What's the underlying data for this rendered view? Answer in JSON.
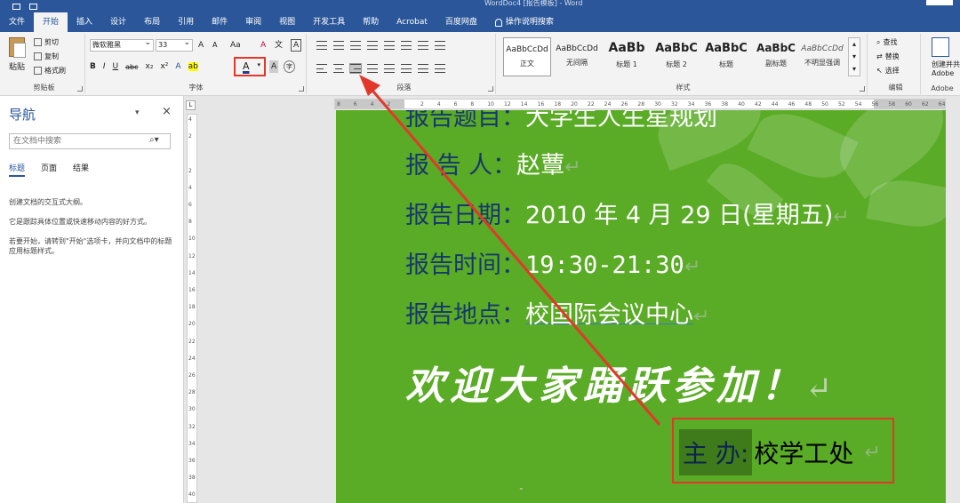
{
  "window": {
    "title": "WordDoc4 [报告模板] - Word"
  },
  "tabs": [
    {
      "label": "文件"
    },
    {
      "label": "开始",
      "active": true
    },
    {
      "label": "插入"
    },
    {
      "label": "设计"
    },
    {
      "label": "布局"
    },
    {
      "label": "引用"
    },
    {
      "label": "邮件"
    },
    {
      "label": "审阅"
    },
    {
      "label": "视图"
    },
    {
      "label": "开发工具"
    },
    {
      "label": "帮助"
    },
    {
      "label": "Acrobat"
    },
    {
      "label": "百度网盘"
    },
    {
      "label": "操作说明搜索"
    }
  ],
  "ribbon": {
    "clipboard": {
      "paste": "粘贴",
      "cut": "剪切",
      "copy": "复制",
      "format_painter": "格式刷",
      "label": "剪贴板"
    },
    "font": {
      "font_name": "微软雅黑",
      "font_size": "33",
      "grow": "A",
      "shrink": "A",
      "case": "Aa",
      "clear_format": "A",
      "pinyin": "文",
      "border": "A",
      "bold": "B",
      "italic": "I",
      "underline": "U",
      "strike": "abc",
      "subscript": "x₂",
      "superscript": "x²",
      "effects": "A",
      "highlight": "ab",
      "font_color": "A",
      "shading": "A",
      "enclose": "字",
      "label": "字体"
    },
    "paragraph": {
      "label": "段落"
    },
    "styles": {
      "label": "样式",
      "items": [
        {
          "sample": "AaBbCcDd",
          "name": "正文",
          "selected": true
        },
        {
          "sample": "AaBbCcDd",
          "name": "无间隔"
        },
        {
          "sample": "AaBb",
          "name": "标题 1"
        },
        {
          "sample": "AaBbC",
          "name": "标题 2"
        },
        {
          "sample": "AaBbC",
          "name": "标题"
        },
        {
          "sample": "AaBbC",
          "name": "副标题"
        },
        {
          "sample": "AaBbCcDd",
          "name": "不明显强调"
        }
      ]
    },
    "editing": {
      "find": "查找",
      "replace": "替换",
      "select": "选择",
      "label": "编辑"
    },
    "adobe": {
      "line1": "创建并共",
      "line2": "Adobe",
      "label": "Adobe"
    }
  },
  "nav": {
    "title": "导航",
    "search_placeholder": "在文档中搜索",
    "tabs": [
      {
        "label": "标题",
        "active": true
      },
      {
        "label": "页面"
      },
      {
        "label": "结果"
      }
    ],
    "text1": "创建文档的交互式大纲。",
    "text2": "它是跟踪具体位置或快速移动内容的好方式。",
    "text3": "若要开始，请转到\"开始\"选项卡，并向文档中的标题应用标题样式。"
  },
  "ruler": {
    "ticks": [
      "8",
      "6",
      "4",
      "2",
      "",
      "2",
      "4",
      "6",
      "8",
      "10",
      "12",
      "14",
      "16",
      "18",
      "20",
      "22",
      "24",
      "26",
      "28",
      "30",
      "32",
      "34",
      "36",
      "38",
      "40",
      "42",
      "44",
      "46",
      "48",
      "50",
      "52",
      "54",
      "56",
      "58",
      "60",
      "62",
      "64"
    ],
    "vticks": [
      "4",
      "",
      "2",
      "",
      "",
      "",
      "2",
      "",
      "4",
      "",
      "6",
      "",
      "8",
      "",
      "10",
      "",
      "12",
      "",
      "14",
      "",
      "16",
      "",
      "18",
      "",
      "20",
      "",
      "22",
      "",
      "24",
      "",
      "26",
      "",
      "28",
      "",
      "30",
      "",
      "32",
      "",
      "34",
      "",
      "36",
      "",
      "38",
      "",
      "40"
    ]
  },
  "document": {
    "line0": {
      "label": "报告题目：",
      "value": "大学生人生星规划"
    },
    "line1": {
      "label": "报 告 人：",
      "value": "赵蕈"
    },
    "line2": {
      "label": "报告日期：",
      "value": "2010 年 4 月 29 日(星期五)"
    },
    "line3": {
      "label": "报告时间：",
      "value": "19:30-21:30"
    },
    "line4": {
      "label": "报告地点：",
      "value": "校国际会议中心"
    },
    "welcome": "欢迎大家踊跃参加！",
    "sponsor_label": "主 办",
    "sponsor_sep": ":",
    "sponsor_value": "校学工处",
    "para_mark": "↵"
  },
  "colors": {
    "accent": "#2b579a",
    "page_bg": "#5aab25",
    "annotation": "#e2382c",
    "label_text": "#16386e"
  }
}
